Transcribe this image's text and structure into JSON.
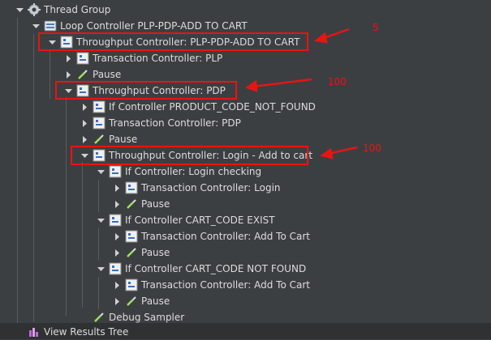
{
  "tree": [
    {
      "id": "thread-group",
      "label": "Thread Group",
      "icon": "gear-icon",
      "arrow": "down"
    },
    {
      "id": "loop-controller",
      "label": "Loop Controller PLP-PDP-ADD TO CART",
      "icon": "loop-icon",
      "arrow": "down"
    },
    {
      "id": "tp-plp-pdp",
      "label": "Throughput Controller: PLP-PDP-ADD TO CART",
      "icon": "controller-icon",
      "arrow": "down"
    },
    {
      "id": "tc-plp",
      "label": "Transaction Controller: PLP",
      "icon": "controller-icon",
      "arrow": "right"
    },
    {
      "id": "pause-1",
      "label": "Pause",
      "icon": "dropper-icon",
      "arrow": "right"
    },
    {
      "id": "tp-pdp",
      "label": "Throughput Controller: PDP",
      "icon": "controller-icon",
      "arrow": "down"
    },
    {
      "id": "if-product",
      "label": "If Controller PRODUCT_CODE_NOT_FOUND",
      "icon": "controller-icon",
      "arrow": "right"
    },
    {
      "id": "tc-pdp",
      "label": "Transaction Controller: PDP",
      "icon": "controller-icon",
      "arrow": "right"
    },
    {
      "id": "pause-2",
      "label": "Pause",
      "icon": "dropper-icon",
      "arrow": "right"
    },
    {
      "id": "tp-login",
      "label": "Throughput Controller: Login - Add to cart",
      "icon": "controller-icon",
      "arrow": "down"
    },
    {
      "id": "if-login",
      "label": "If Controller: Login checking",
      "icon": "controller-icon",
      "arrow": "down"
    },
    {
      "id": "tc-login",
      "label": "Transaction Controller: Login",
      "icon": "controller-icon",
      "arrow": "right"
    },
    {
      "id": "pause-3",
      "label": "Pause",
      "icon": "dropper-icon",
      "arrow": "right"
    },
    {
      "id": "if-cart-exist",
      "label": "If Controller CART_CODE EXIST",
      "icon": "controller-icon",
      "arrow": "down"
    },
    {
      "id": "tc-add-1",
      "label": "Transaction Controller: Add To Cart",
      "icon": "controller-icon",
      "arrow": "right"
    },
    {
      "id": "pause-4",
      "label": "Pause",
      "icon": "dropper-icon",
      "arrow": "right"
    },
    {
      "id": "if-cart-notfound",
      "label": "If Controller CART_CODE NOT FOUND",
      "icon": "controller-icon",
      "arrow": "down"
    },
    {
      "id": "tc-add-2",
      "label": "Transaction Controller: Add To Cart",
      "icon": "controller-icon",
      "arrow": "right"
    },
    {
      "id": "pause-5",
      "label": "Pause",
      "icon": "dropper-icon",
      "arrow": "right"
    },
    {
      "id": "debug",
      "label": "Debug Sampler",
      "icon": "dropper-icon",
      "arrow": "none"
    },
    {
      "id": "view-results",
      "label": "View Results Tree",
      "icon": "chart-icon",
      "arrow": "none"
    }
  ],
  "annotations": {
    "tp_plp_pdp_value": "5",
    "tp_pdp_value": "100",
    "tp_login_value": "100"
  },
  "colors": {
    "background": "#3c3f41",
    "text": "#dcdcdc",
    "highlight": "#e81414"
  }
}
